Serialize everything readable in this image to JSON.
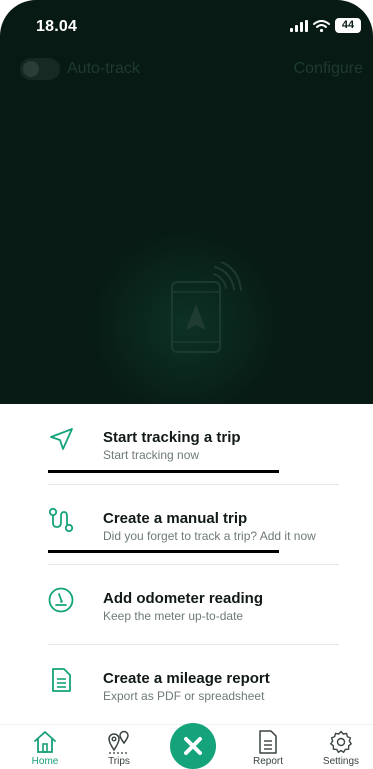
{
  "status_bar": {
    "time": "18.04",
    "battery": "44"
  },
  "header": {
    "autotrack_label": "Auto-track",
    "configure_label": "Configure"
  },
  "actions": [
    {
      "title": "Start tracking a trip",
      "subtitle": "Start tracking now",
      "icon": "navigation-arrow-icon"
    },
    {
      "title": "Create a manual trip",
      "subtitle": "Did you forget to track a trip? Add it now",
      "icon": "route-icon"
    },
    {
      "title": "Add odometer reading",
      "subtitle": "Keep the meter up-to-date",
      "icon": "odometer-icon"
    },
    {
      "title": "Create a mileage report",
      "subtitle": "Export as PDF or spreadsheet",
      "icon": "document-icon"
    }
  ],
  "tabbar": {
    "items": [
      {
        "label": "Home",
        "icon": "home-icon",
        "active": true
      },
      {
        "label": "Trips",
        "icon": "trips-pin-icon"
      },
      {
        "label": "Report",
        "icon": "report-document-icon"
      },
      {
        "label": "Settings",
        "icon": "gear-icon"
      }
    ],
    "center_icon": "close-icon"
  },
  "colors": {
    "accent": "#14a37a",
    "dark_background": "#071a14",
    "active_tab": "#169f78"
  }
}
